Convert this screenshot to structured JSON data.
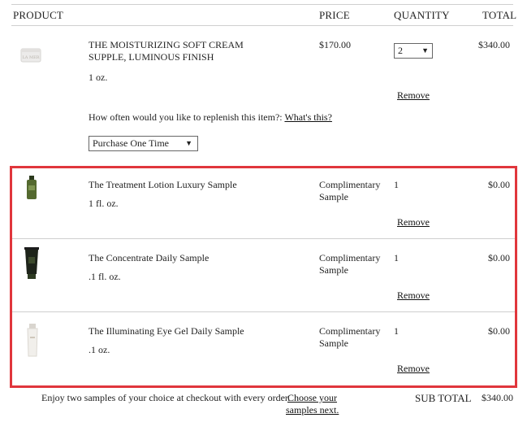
{
  "header": {
    "product": "PRODUCT",
    "price": "PRICE",
    "quantity": "QUANTITY",
    "total": "TOTAL"
  },
  "items": [
    {
      "name_line1": "THE MOISTURIZING SOFT CREAM",
      "name_line2": "SUPPLE, LUMINOUS FINISH",
      "size": "1 oz.",
      "price": "$170.00",
      "quantity": "2",
      "total": "$340.00",
      "remove": "Remove",
      "replenish_prompt": "How often would you like to replenish this item?:",
      "whats_this": "What's this?",
      "replenish_value": "Purchase One Time"
    },
    {
      "name": "The Treatment Lotion Luxury Sample",
      "size": "1 fl. oz.",
      "price_line1": "Complimentary",
      "price_line2": "Sample",
      "quantity": "1",
      "total": "$0.00",
      "remove": "Remove"
    },
    {
      "name": "The Concentrate Daily Sample",
      "size": ".1 fl. oz.",
      "price_line1": "Complimentary",
      "price_line2": "Sample",
      "quantity": "1",
      "total": "$0.00",
      "remove": "Remove"
    },
    {
      "name": "The Illuminating Eye Gel Daily Sample",
      "size": ".1 oz.",
      "price_line1": "Complimentary",
      "price_line2": "Sample",
      "quantity": "1",
      "total": "$0.00",
      "remove": "Remove"
    }
  ],
  "footer": {
    "promo_text": "Enjoy two samples of your choice at checkout with every order.",
    "promo_link_line1": "Choose your",
    "promo_link_line2": "samples next.",
    "subtotal_label": "SUB TOTAL",
    "subtotal_value": "$340.00"
  },
  "colors": {
    "highlight_border": "#e0363c"
  }
}
